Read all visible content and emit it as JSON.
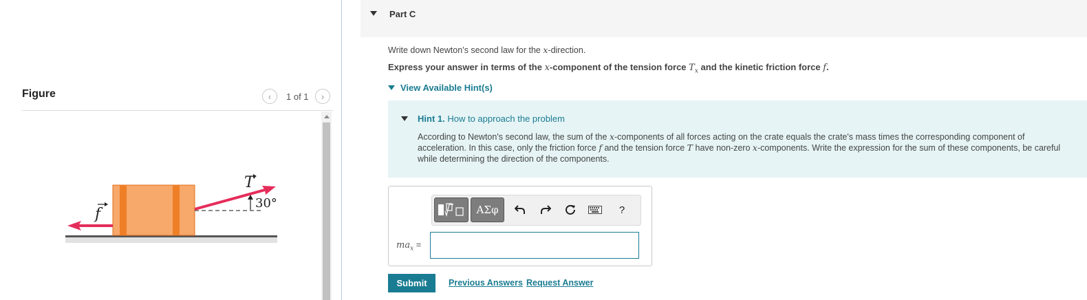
{
  "figure": {
    "title": "Figure",
    "page_counter": "1 of 1",
    "labels": {
      "tension": "T",
      "friction": "f",
      "angle": "30°"
    },
    "colors": {
      "crate": "#f7a86b",
      "crate_dark": "#ee7f26",
      "arrow": "#e52d5a"
    }
  },
  "part": {
    "title": "Part C"
  },
  "question": {
    "instruction_pre": "Write down Newton’s second law for the ",
    "instruction_var": "x",
    "instruction_post": "-direction.",
    "express_pre": "Express your answer in terms of the ",
    "express_var": "x",
    "express_mid": "-component of the tension force ",
    "express_T": "T",
    "express_Tsub": "x",
    "express_mid2": " and the kinetic friction force ",
    "express_f": "f",
    "express_end": "."
  },
  "hints": {
    "toggle_label": "View Available Hint(s)",
    "hint1_number": "Hint 1.",
    "hint1_title": "How to approach the problem",
    "b1": "According to Newton's second law, the sum of the ",
    "b1_var": "x",
    "b2": "-components of all forces acting on the crate equals the crate's mass times the corresponding component of acceleration. In this case, only the friction force ",
    "b2_var": "f",
    "b3": " and the tension force ",
    "b3_var": "T",
    "b4": " have non-zero ",
    "b4_var": "x",
    "b5": "-components. Write the expression for the sum of these components, be careful while determining the direction of the components."
  },
  "answer": {
    "label_m": "ma",
    "label_sub": "x",
    "label_eq": " =",
    "value": ""
  },
  "toolbar": {
    "symbols_label": "ΑΣφ",
    "help_label": "?"
  },
  "actions": {
    "submit_label": "Submit",
    "previous_answers_label": "Previous Answers",
    "request_answer_label": "Request Answer"
  }
}
